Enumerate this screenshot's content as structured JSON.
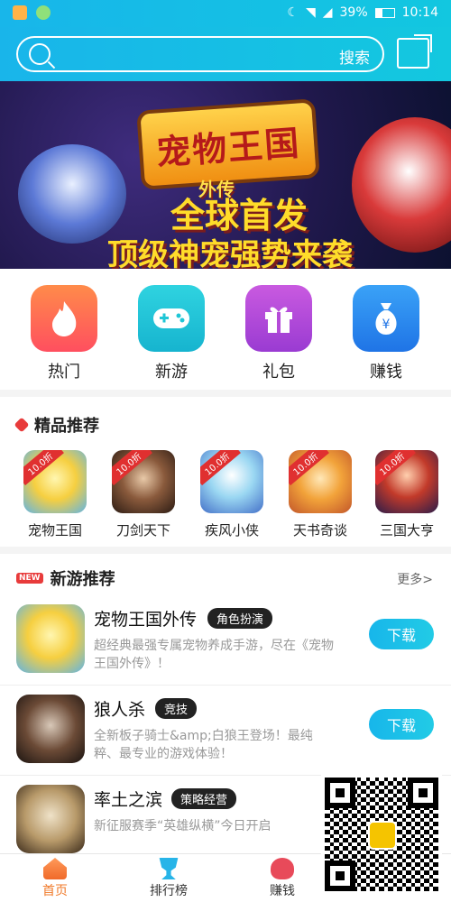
{
  "status": {
    "battery": "39%",
    "time": "10:14"
  },
  "header": {
    "search_label": "搜索"
  },
  "banner": {
    "title_logo": "宠物王国",
    "subtitle_logo": "外传",
    "line1": "全球首发",
    "line2": "顶级神宠强势来袭"
  },
  "categories": [
    {
      "label": "热门",
      "icon": "flame-icon",
      "color": "#ff6b3d"
    },
    {
      "label": "新游",
      "icon": "gamepad-icon",
      "color": "#1fc6d6"
    },
    {
      "label": "礼包",
      "icon": "gift-icon",
      "color": "#b54bd8"
    },
    {
      "label": "赚钱",
      "icon": "money-bag-icon",
      "color": "#2f8df2"
    }
  ],
  "picks_section": {
    "title": "精品推荐"
  },
  "picks": [
    {
      "name": "宠物王国",
      "tag": "10.0折"
    },
    {
      "name": "刀剑天下",
      "tag": "10.0折"
    },
    {
      "name": "疾风小侠",
      "tag": "10.0折"
    },
    {
      "name": "天书奇谈",
      "tag": "10.0折"
    },
    {
      "name": "三国大亨",
      "tag": "10.0折"
    }
  ],
  "new_section": {
    "badge": "NEW",
    "title": "新游推荐",
    "more": "更多>"
  },
  "new_games": [
    {
      "name": "宠物王国外传",
      "badge": "角色扮演",
      "desc": "超经典最强专属宠物养成手游，尽在《宠物王国外传》！",
      "button": "下载"
    },
    {
      "name": "狼人杀",
      "badge": "竞技",
      "desc": "全新板子骑士&amp;白狼王登场！最纯粹、最专业的游戏体验！",
      "button": "下载"
    },
    {
      "name": "率土之滨",
      "badge": "策略经营",
      "desc": "新征服赛季“英雄纵横”今日开启",
      "button": ""
    }
  ],
  "tabbar": {
    "tabs": [
      "首页",
      "排行榜",
      "赚钱"
    ]
  }
}
